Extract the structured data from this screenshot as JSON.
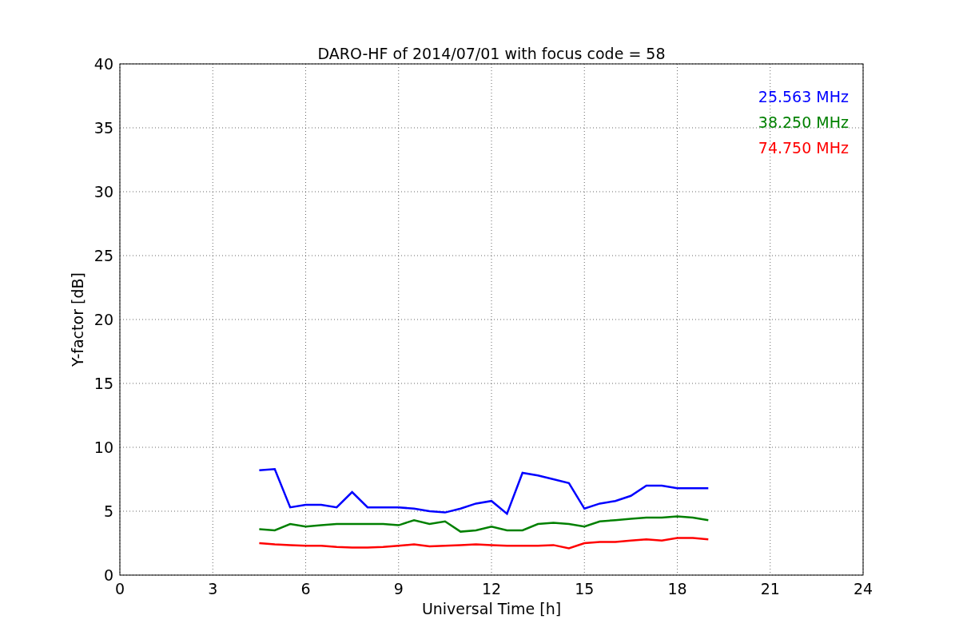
{
  "figure": {
    "chart_data": {
      "type": "line",
      "title": "DARO-HF of 2014/07/01 with focus code = 58",
      "xlabel": "Universal Time [h]",
      "ylabel": "Y-factor [dB]",
      "x": [
        4.5,
        5,
        5.5,
        6,
        6.5,
        7,
        7.5,
        8,
        8.5,
        9,
        9.5,
        10,
        10.5,
        11,
        11.5,
        12,
        12.5,
        13,
        13.5,
        14,
        14.5,
        15,
        15.5,
        16,
        16.5,
        17,
        17.5,
        18,
        18.5,
        19
      ],
      "series": [
        {
          "name": "25.563 MHz",
          "color": "#0000ff",
          "values": [
            8.2,
            8.3,
            5.3,
            5.5,
            5.5,
            5.3,
            6.5,
            5.3,
            5.3,
            5.3,
            5.2,
            5.0,
            4.9,
            5.2,
            5.6,
            5.8,
            4.8,
            8.0,
            7.8,
            7.5,
            7.2,
            5.2,
            5.6,
            5.8,
            6.2,
            7.0,
            7.0,
            6.8,
            6.8,
            6.8
          ]
        },
        {
          "name": "38.250 MHz",
          "color": "#008000",
          "values": [
            3.6,
            3.5,
            4.0,
            3.8,
            3.9,
            4.0,
            4.0,
            4.0,
            4.0,
            3.9,
            4.3,
            4.0,
            4.2,
            3.4,
            3.5,
            3.8,
            3.5,
            3.5,
            4.0,
            4.1,
            4.0,
            3.8,
            4.2,
            4.3,
            4.4,
            4.5,
            4.5,
            4.6,
            4.5,
            4.3
          ]
        },
        {
          "name": "74.750 MHz",
          "color": "#ff0000",
          "values": [
            2.5,
            2.4,
            2.35,
            2.3,
            2.3,
            2.2,
            2.15,
            2.15,
            2.2,
            2.3,
            2.4,
            2.25,
            2.3,
            2.35,
            2.4,
            2.35,
            2.3,
            2.3,
            2.3,
            2.35,
            2.1,
            2.5,
            2.6,
            2.6,
            2.7,
            2.8,
            2.7,
            2.9,
            2.9,
            2.8
          ]
        }
      ],
      "grid": true,
      "xlim": [
        0,
        24
      ],
      "ylim": [
        0,
        40
      ],
      "xticks": [
        0,
        3,
        6,
        9,
        12,
        15,
        18,
        21,
        24
      ],
      "yticks": [
        0,
        5,
        10,
        15,
        20,
        25,
        30,
        35,
        40
      ]
    }
  }
}
